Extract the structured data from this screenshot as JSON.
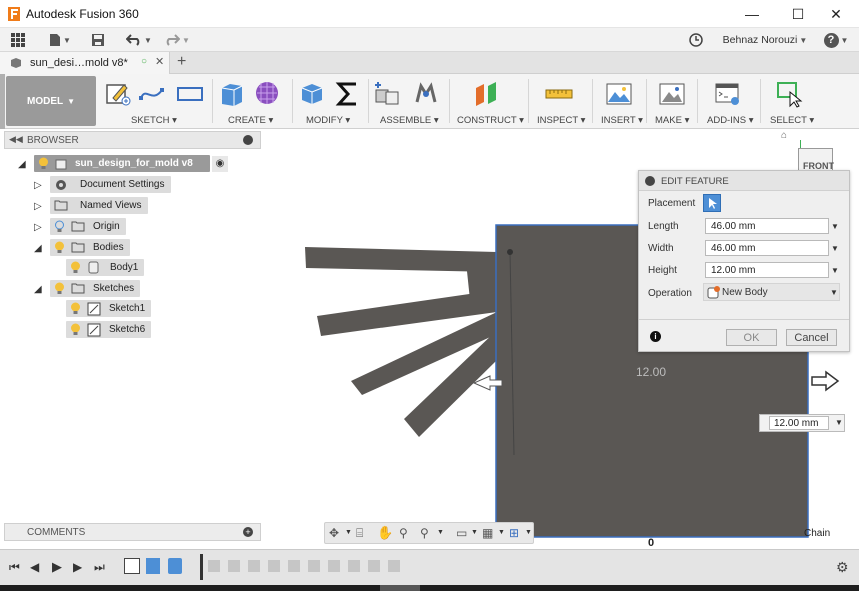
{
  "app": {
    "title": "Autodesk Fusion 360",
    "user": "Behnaz Norouzi",
    "help": "?"
  },
  "document": {
    "tab_label": "sun_desi…mold v8*"
  },
  "ribbon": {
    "workspace": "MODEL",
    "groups": {
      "sketch": "SKETCH",
      "create": "CREATE",
      "modify": "MODIFY",
      "assemble": "ASSEMBLE",
      "construct": "CONSTRUCT",
      "inspect": "INSPECT",
      "insert": "INSERT",
      "make": "MAKE",
      "addins": "ADD-INS",
      "select": "SELECT"
    }
  },
  "browser": {
    "header": "BROWSER",
    "root": "sun_design_for_mold v8",
    "items": [
      {
        "label": "Document Settings"
      },
      {
        "label": "Named Views"
      },
      {
        "label": "Origin"
      },
      {
        "label": "Bodies"
      },
      {
        "label": "Body1"
      },
      {
        "label": "Sketches"
      },
      {
        "label": "Sketch1"
      },
      {
        "label": "Sketch6"
      }
    ]
  },
  "comments": {
    "header": "COMMENTS"
  },
  "viewcube": {
    "face": "FRONT"
  },
  "edit_feature": {
    "title": "EDIT FEATURE",
    "placement_label": "Placement",
    "length_label": "Length",
    "length_value": "46.00 mm",
    "width_label": "Width",
    "width_value": "46.00 mm",
    "height_label": "Height",
    "height_value": "12.00 mm",
    "operation_label": "Operation",
    "operation_value": "New Body",
    "ok_label": "OK",
    "cancel_label": "Cancel"
  },
  "canvas": {
    "height_annotation": "12.00",
    "dimension_input": "12.00 mm",
    "chain_label": "Chain",
    "zero_label": "0"
  },
  "colors": {
    "body_fill": "#5a5754",
    "selection_blue": "#3a6fbf",
    "ribbon_bg": "#f4f4f4"
  }
}
